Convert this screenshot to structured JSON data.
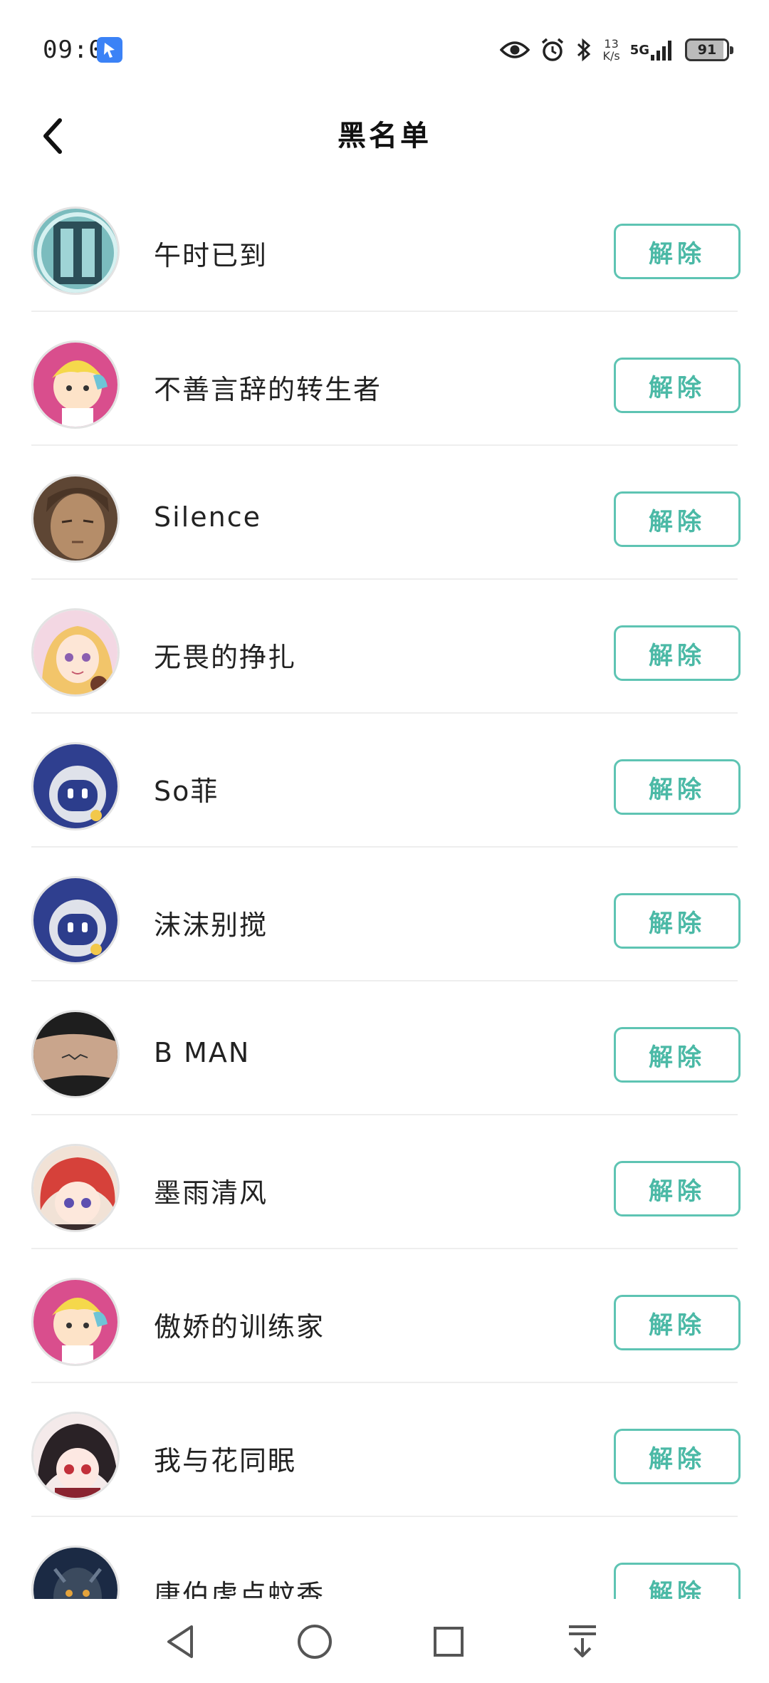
{
  "status_bar": {
    "time": "09:09",
    "net_speed_top": "13",
    "net_speed_bottom": "K/s",
    "network": "5G",
    "battery": "91"
  },
  "header": {
    "title": "黑名单",
    "back_icon": "chevron-left-icon"
  },
  "colors": {
    "accent": "#4bb9a6",
    "accent_border": "#5ec4b3",
    "divider": "#eeeeee"
  },
  "list": [
    {
      "name": "午时已到",
      "button": "解除"
    },
    {
      "name": "不善言辞的转生者",
      "button": "解除"
    },
    {
      "name": "Silence",
      "button": "解除"
    },
    {
      "name": "无畏的挣扎",
      "button": "解除"
    },
    {
      "name": "So菲",
      "button": "解除"
    },
    {
      "name": "沫沫别搅",
      "button": "解除"
    },
    {
      "name": "B MAN",
      "button": "解除"
    },
    {
      "name": "墨雨清风",
      "button": "解除"
    },
    {
      "name": "傲娇的训练家",
      "button": "解除"
    },
    {
      "name": "我与花同眠",
      "button": "解除"
    },
    {
      "name": "唐伯虎点蚊香",
      "button": "解除"
    }
  ],
  "nav_bar": {
    "back": "triangle-back-icon",
    "home": "circle-home-icon",
    "recents": "square-recents-icon",
    "notifications": "pull-down-icon"
  }
}
